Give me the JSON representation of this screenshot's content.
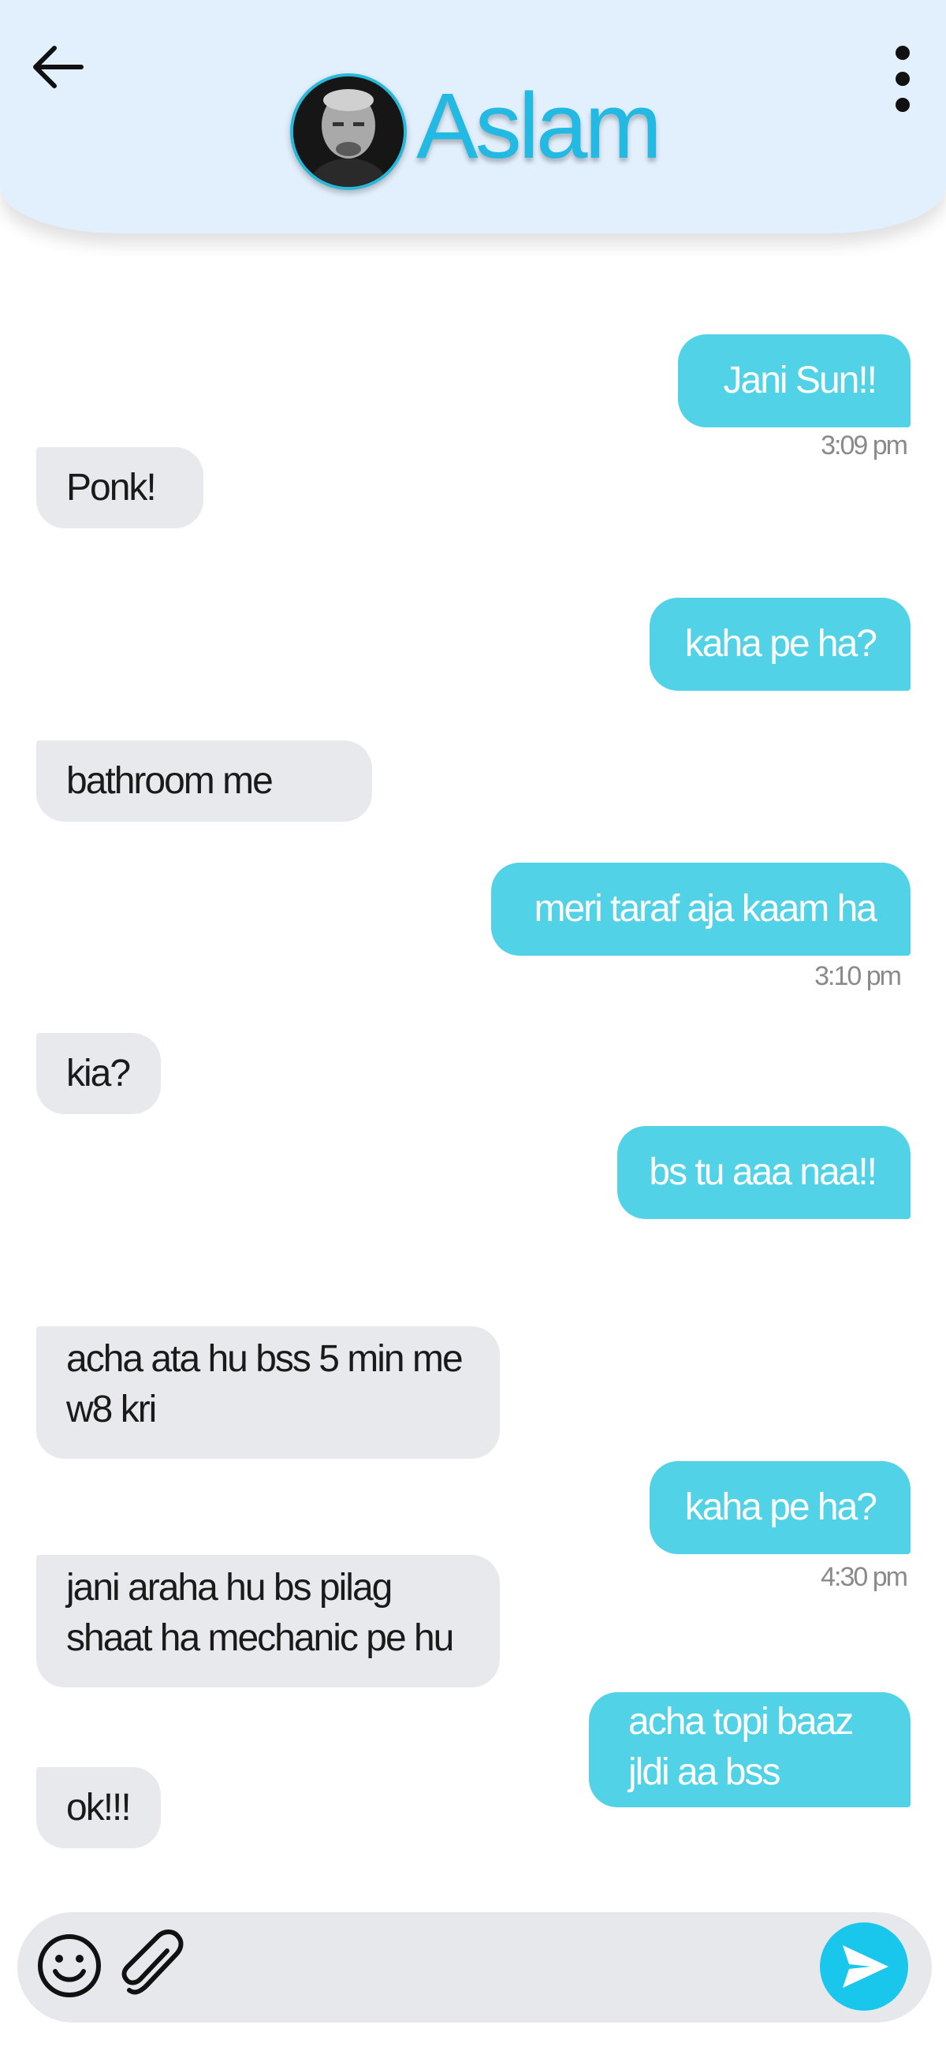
{
  "header": {
    "contact_name": "Aslam",
    "back_icon": "arrow-left-icon",
    "menu_icon": "more-vertical-icon"
  },
  "messages": [
    {
      "direction": "sent",
      "text": "Jani Sun!!",
      "time": "3:09 pm"
    },
    {
      "direction": "received",
      "text": "Ponk!"
    },
    {
      "direction": "sent",
      "text": "kaha pe ha?"
    },
    {
      "direction": "received",
      "text": "bathroom me"
    },
    {
      "direction": "sent",
      "text": "meri taraf aja kaam ha",
      "time": "3:10 pm"
    },
    {
      "direction": "received",
      "text": "kia?"
    },
    {
      "direction": "sent",
      "text": "bs tu aaa naa!!"
    },
    {
      "direction": "received",
      "lines": [
        "acha ata hu bss 5 min me",
        "w8 kri"
      ]
    },
    {
      "direction": "sent",
      "text": "kaha pe ha?",
      "time": "4:30 pm"
    },
    {
      "direction": "received",
      "lines": [
        "jani araha hu bs pilag",
        "shaat ha mechanic pe hu"
      ]
    },
    {
      "direction": "sent",
      "lines": [
        "acha topi baaz",
        "jldi aa bss"
      ]
    },
    {
      "direction": "received",
      "text": "ok!!!"
    }
  ],
  "composer": {
    "emoji_icon": "smiley-icon",
    "attach_icon": "paperclip-icon",
    "send_icon": "send-icon"
  },
  "colors": {
    "header_bg": "#e2effc",
    "accent": "#22b9e3",
    "sent_bubble": "#52d2e7",
    "received_bubble": "#e7e9ec",
    "send_button": "#19c7ec"
  }
}
